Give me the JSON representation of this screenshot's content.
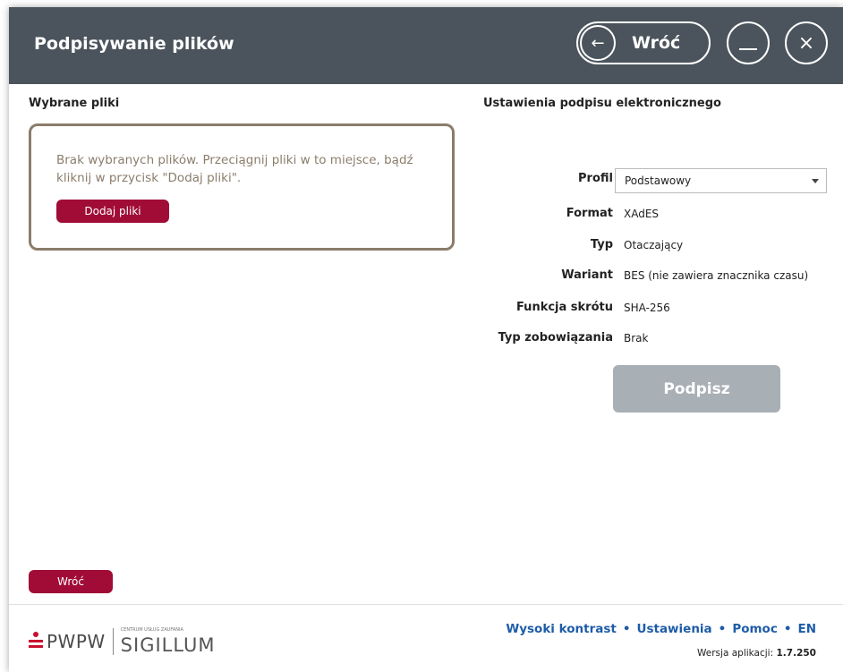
{
  "header": {
    "title": "Podpisywanie plików",
    "back_label": "Wróć",
    "back_icon": "arrow-left-icon",
    "minimize_icon": "minimize-icon",
    "close_icon": "close-icon"
  },
  "files": {
    "heading": "Wybrane pliki",
    "empty_text": "Brak wybranych plików. Przeciągnij pliki w to miejsce, bądź kliknij w przycisk \"Dodaj pliki\".",
    "add_button": "Dodaj pliki",
    "back_button": "Wróć"
  },
  "settings": {
    "heading": "Ustawienia podpisu elektronicznego",
    "rows": [
      {
        "label": "Profil",
        "value": "Podstawowy"
      },
      {
        "label": "Format",
        "value": "XAdES"
      },
      {
        "label": "Typ",
        "value": "Otaczający"
      },
      {
        "label": "Wariant",
        "value": "BES (nie zawiera znacznika czasu)"
      },
      {
        "label": "Funkcja skrótu",
        "value": "SHA-256"
      },
      {
        "label": "Typ zobowiązania",
        "value": "Brak"
      }
    ],
    "sign_button": "Podpisz"
  },
  "footer": {
    "logo_pwpw": "PWPW",
    "logo_small": "CENTRUM USŁUG ZAUFANIA",
    "logo_sigillum": "SIGILLUM",
    "links": [
      "Wysoki kontrast",
      "Ustawienia",
      "Pomoc",
      "EN"
    ],
    "version_label": "Wersja aplikacji:",
    "version_value": "1.7.250"
  },
  "colors": {
    "header_bg": "#4b545c",
    "primary": "#a00c36",
    "disabled": "#a8afb5",
    "dropzone_border": "#8b7d6b",
    "link": "#1e5ca8"
  }
}
